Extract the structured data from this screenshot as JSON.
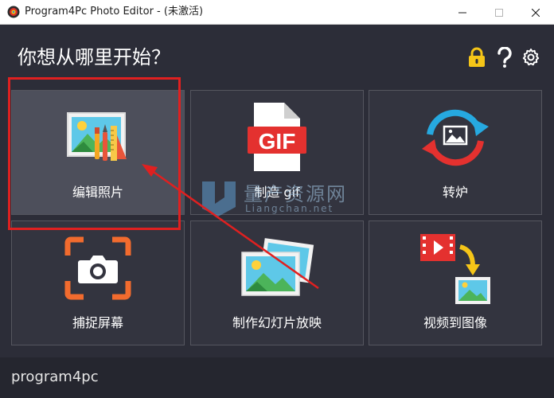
{
  "window": {
    "title": "Program4Pc Photo Editor - (未激活)"
  },
  "header": {
    "heading": "你想从哪里开始？",
    "icons": [
      "lock-icon",
      "help-icon",
      "gear-icon"
    ]
  },
  "tiles": [
    {
      "label": "编辑照片",
      "icon": "edit-photo-icon",
      "selected": true
    },
    {
      "label": "制造 gif",
      "icon": "gif-file-icon",
      "selected": false
    },
    {
      "label": "转炉",
      "icon": "convert-icon",
      "selected": false
    },
    {
      "label": "捕捉屏幕",
      "icon": "camera-capture-icon",
      "selected": false
    },
    {
      "label": "制作幻灯片放映",
      "icon": "slideshow-icon",
      "selected": false
    },
    {
      "label": "视频到图像",
      "icon": "video-to-image-icon",
      "selected": false
    }
  ],
  "gif_icon_text": "GIF",
  "watermark": {
    "cn": "量产资源网",
    "en": "Liangchan.net"
  },
  "footer": {
    "brand": "program4pc"
  },
  "colors": {
    "background": "#2c2d38",
    "tile": "#33343f",
    "tile_selected": "#4d4f5b",
    "annotation_red": "#e02020",
    "gif_red": "#e4312f",
    "accent_orange": "#f26b2e",
    "lock_yellow": "#f5c518"
  }
}
